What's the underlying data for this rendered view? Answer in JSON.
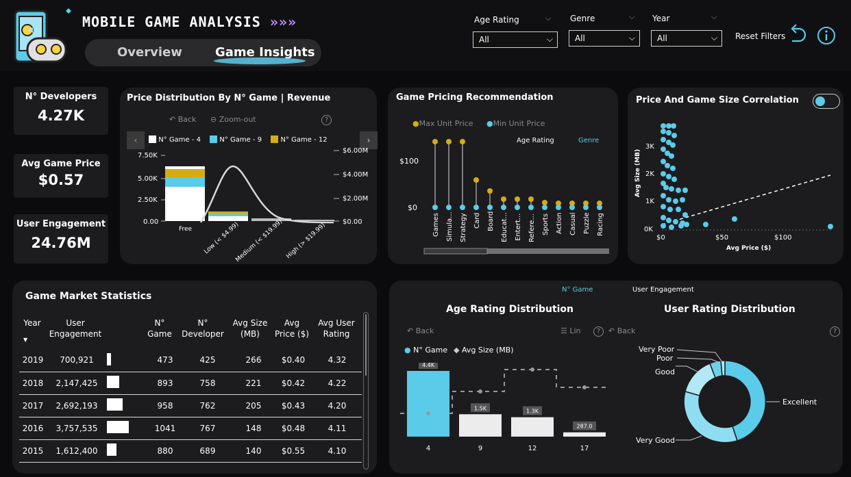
{
  "header": {
    "title": "MOBILE GAME ANALYSIS",
    "title_arrows": "»»»",
    "tabs": [
      {
        "label": "Overview"
      },
      {
        "label": "Game Insights"
      }
    ],
    "filters": {
      "age_rating": {
        "label": "Age Rating",
        "value": "All"
      },
      "genre": {
        "label": "Genre",
        "value": "All"
      },
      "year": {
        "label": "Year",
        "value": "All"
      }
    },
    "reset_label": "Reset Filters"
  },
  "kpis": [
    {
      "label": "N° Developers",
      "value": "4.27K"
    },
    {
      "label": "Avg Game Price",
      "value": "$0.57"
    },
    {
      "label": "User Engagement",
      "value": "24.76M"
    }
  ],
  "price_dist": {
    "title": "Price Distribution By N° Game | Revenue",
    "back": "Back",
    "zoom_out": "Zoom-out",
    "help": "?",
    "legend": [
      {
        "label": "N° Game - 4",
        "color": "#ffffff"
      },
      {
        "label": "N° Game - 9",
        "color": "#5bcbea"
      },
      {
        "label": "N° Game - 12",
        "color": "#d4ad12"
      }
    ],
    "left_ticks": [
      "7.50K",
      "5.00K",
      "2.50K",
      "0.00"
    ],
    "right_ticks": [
      "$6.00M",
      "$4.00M",
      "$2.00M",
      "$0.00"
    ],
    "categories": [
      "Free",
      "Low (< $4.99)",
      "Medium (< $19.99)",
      "High (> $19.99)"
    ]
  },
  "pricing": {
    "title": "Game Pricing Recommendation",
    "legend_max": "Max Unit Price",
    "legend_min": "Min Unit Price",
    "tab_age": "Age Rating",
    "tab_genre": "Genre",
    "y_ticks": [
      "$100",
      "$0"
    ],
    "genres": [
      "Games",
      "Simula...",
      "Strategy",
      "Card",
      "Board",
      "Educat...",
      "Entert...",
      "Refere...",
      "Sports",
      "Action",
      "Casual",
      "Puzzle",
      "Racing"
    ]
  },
  "correlation": {
    "title": "Price And Game Size Correlation",
    "y_label": "Avg Size (MB)",
    "x_label": "Avg Price ($)",
    "y_ticks": [
      "3K",
      "2K",
      "1K",
      "0K"
    ],
    "x_ticks": [
      "$0",
      "$50",
      "$100"
    ]
  },
  "market": {
    "title": "Game Market Statistics",
    "columns": [
      "Year",
      "User Engagement",
      "N° Game",
      "N° Developer",
      "Avg Size (MB)",
      "Avg Price ($)",
      "Avg User Rating"
    ],
    "rows": [
      {
        "year": "2019",
        "engagement": "700,921",
        "games": "473",
        "devs": "425",
        "size": "266",
        "price": "$0.40",
        "rating": "4.32"
      },
      {
        "year": "2018",
        "engagement": "2,147,425",
        "games": "893",
        "devs": "758",
        "size": "221",
        "price": "$0.42",
        "rating": "4.22"
      },
      {
        "year": "2017",
        "engagement": "2,692,193",
        "games": "958",
        "devs": "762",
        "size": "205",
        "price": "$0.43",
        "rating": "4.20"
      },
      {
        "year": "2016",
        "engagement": "3,757,535",
        "games": "1041",
        "devs": "767",
        "size": "148",
        "price": "$0.48",
        "rating": "4.11"
      },
      {
        "year": "2015",
        "engagement": "1,612,400",
        "games": "880",
        "devs": "689",
        "size": "140",
        "price": "$0.55",
        "rating": "4.10"
      }
    ]
  },
  "bottom_right": {
    "toggle_game": "N° Game",
    "toggle_engagement": "User Engagement",
    "age_title": "Age Rating Distribution",
    "user_title": "User Rating Distribution",
    "back": "Back",
    "lin": "Lin",
    "legend_game": "N° Game",
    "legend_size": "Avg Size (MB)"
  },
  "user_rating": {
    "labels": [
      "Very Poor",
      "Poor",
      "Good",
      "Excellent",
      "Very Good"
    ]
  },
  "colors": {
    "accent": "#5bcbea",
    "gold": "#d4ad12",
    "panel": "#1c1c1e"
  },
  "chart_data": [
    {
      "type": "bar",
      "title": "Age Rating Distribution",
      "categories": [
        "4",
        "9",
        "12",
        "17"
      ],
      "series": [
        {
          "name": "N° Game",
          "values": [
            4400,
            1500,
            1300,
            287
          ]
        }
      ],
      "data_labels": [
        "4.4K",
        "1.5K",
        "1.3K",
        "287.0"
      ]
    }
  ]
}
